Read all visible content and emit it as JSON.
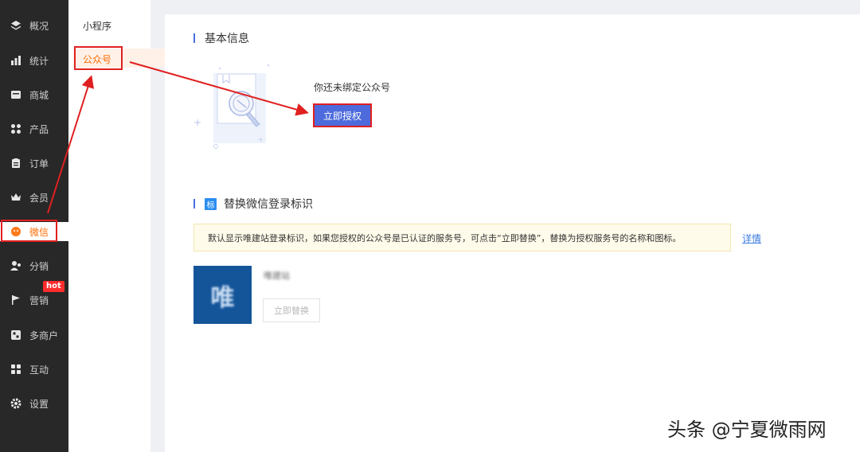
{
  "sidebar": {
    "items": [
      {
        "label": "概况",
        "icon": "layers-icon"
      },
      {
        "label": "统计",
        "icon": "chart-icon"
      },
      {
        "label": "商城",
        "icon": "store-icon"
      },
      {
        "label": "产品",
        "icon": "grid-icon"
      },
      {
        "label": "订单",
        "icon": "clipboard-icon"
      },
      {
        "label": "会员",
        "icon": "crown-icon"
      },
      {
        "label": "微信",
        "icon": "wechat-icon"
      },
      {
        "label": "分销",
        "icon": "users-icon"
      },
      {
        "label": "营销",
        "icon": "flag-icon"
      },
      {
        "label": "多商户",
        "icon": "shop-icon"
      },
      {
        "label": "互动",
        "icon": "apps-icon"
      },
      {
        "label": "设置",
        "icon": "gear-icon"
      }
    ],
    "hot_badge": "hot",
    "active": "微信"
  },
  "submenu": {
    "items": [
      {
        "label": "小程序"
      },
      {
        "label": "公众号"
      }
    ],
    "active": "公众号"
  },
  "basic_info": {
    "title": "基本信息",
    "bind_text": "你还未绑定公众号",
    "auth_button": "立即授权"
  },
  "replace_section": {
    "tag": "标",
    "title": "替换微信登录标识",
    "notice": "默认显示唯建站登录标识，如果您授权的公众号是已认证的服务号，可点击“立即替换”，替换为授权服务号的名称和图标。",
    "detail_link": "详情",
    "logo_char": "唯",
    "site_name": "唯建站",
    "replace_button": "立即替换"
  },
  "watermark": "头条 @宁夏微雨网",
  "colors": {
    "accent": "#4d6bdc",
    "active_orange": "#ff6b00",
    "highlight_red": "#e02020",
    "sidebar_bg": "#282828"
  }
}
